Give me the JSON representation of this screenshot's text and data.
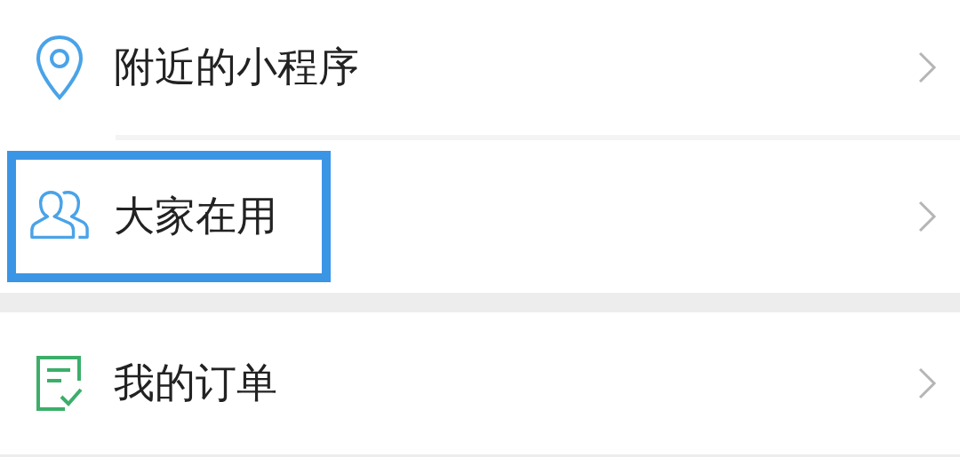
{
  "sections": [
    [
      {
        "kind": "pin",
        "label": "附近的小程序",
        "highlighted": false
      },
      {
        "kind": "people",
        "label": "大家在用",
        "highlighted": true
      }
    ],
    [
      {
        "kind": "order",
        "label": "我的订单",
        "highlighted": false
      }
    ]
  ]
}
